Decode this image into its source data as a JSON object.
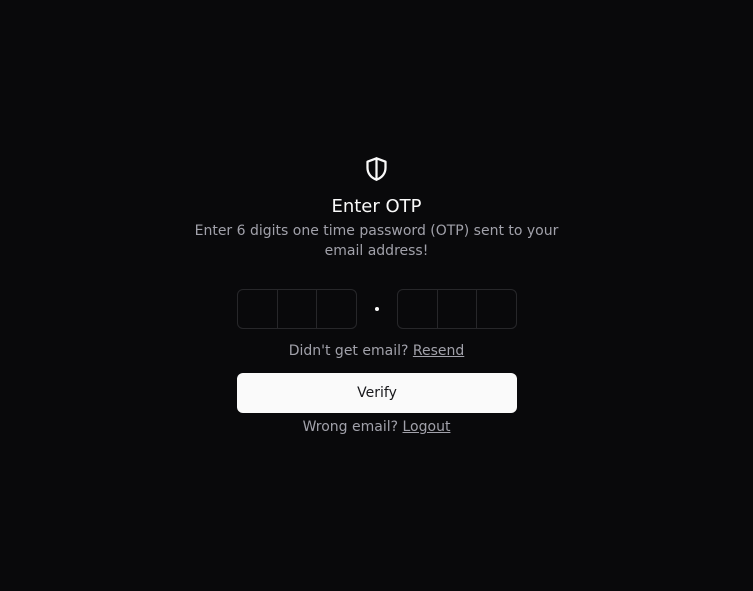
{
  "header": {
    "icon": "shield-half-icon",
    "title": "Enter OTP",
    "subtitle": "Enter 6 digits one time password (OTP) sent to your email address!"
  },
  "otp": {
    "group1": [
      "",
      "",
      ""
    ],
    "group2": [
      "",
      "",
      ""
    ]
  },
  "resend": {
    "prompt": "Didn't get email?",
    "link": "Resend"
  },
  "verify_button": {
    "label": "Verify"
  },
  "logout": {
    "prompt": "Wrong email?",
    "link": "Logout"
  },
  "colors": {
    "background": "#09090b",
    "foreground": "#fafafa",
    "muted": "#a1a1aa",
    "border": "#27272a"
  }
}
